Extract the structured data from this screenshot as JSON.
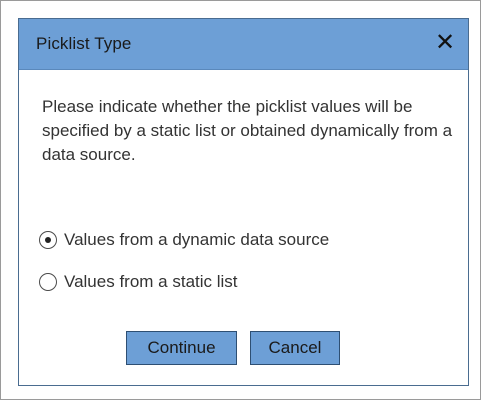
{
  "dialog": {
    "title": "Picklist Type",
    "close_icon": "close-icon",
    "close_glyph": "✕",
    "message": "Please indicate whether the picklist values will be specified by a static list or obtained dynamically from a data source.",
    "options": [
      {
        "label": "Values from a dynamic data source",
        "selected": true
      },
      {
        "label": "Values from a static list",
        "selected": false
      }
    ],
    "buttons": {
      "continue_label": "Continue",
      "cancel_label": "Cancel"
    }
  },
  "colors": {
    "titlebar_bg": "#6d9fd6",
    "button_bg": "#6d9fd6",
    "dialog_border": "#4a6c90",
    "text": "#333333"
  }
}
